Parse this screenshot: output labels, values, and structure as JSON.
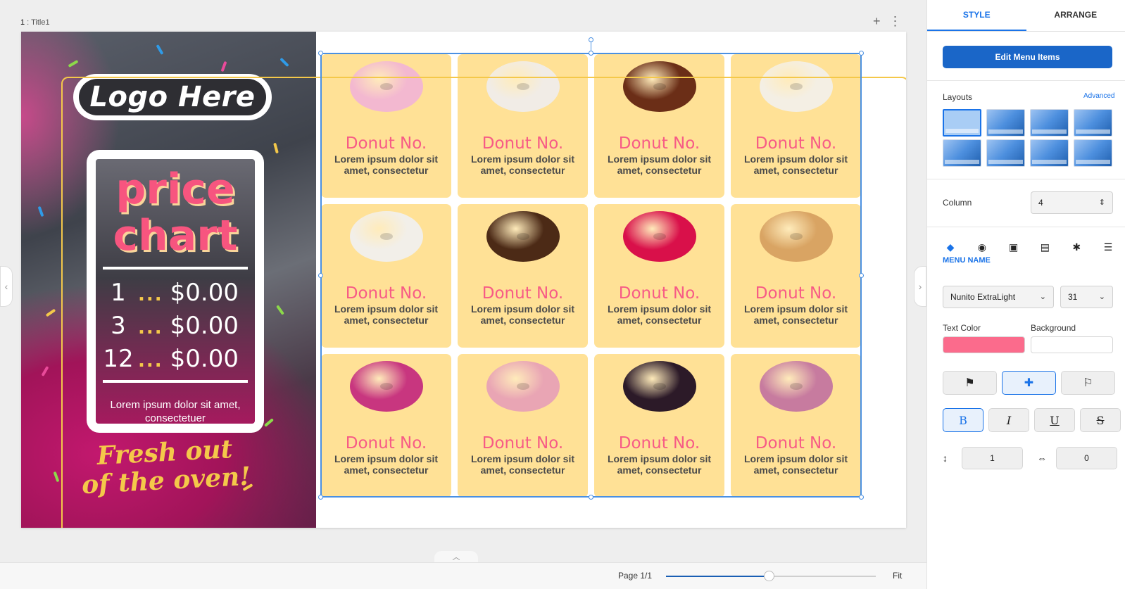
{
  "canvas": {
    "page_label_number": "1",
    "page_label_name": "Title1",
    "add_icon": "plus-icon",
    "more_icon": "more-vertical-icon"
  },
  "slide": {
    "logo_text": "Logo Here",
    "price_title_line1": "price",
    "price_title_line2": "chart",
    "price_rows": [
      {
        "qty": "1",
        "dots": "...",
        "price": "$0.00"
      },
      {
        "qty": "3",
        "dots": "...",
        "price": "$0.00"
      },
      {
        "qty": "12",
        "dots": "...",
        "price": "$0.00"
      }
    ],
    "price_description": "Lorem ipsum dolor sit amet, consectetuer",
    "tagline_line1": "Fresh out",
    "tagline_line2": "of the oven!",
    "menu_items": [
      {
        "name": "Donut No.",
        "description": "Lorem ipsum dolor sit amet, consectetur",
        "donut_color": "#f3b8d0"
      },
      {
        "name": "Donut No.",
        "description": "Lorem ipsum dolor sit amet, consectetur",
        "donut_color": "#f1ece6"
      },
      {
        "name": "Donut No.",
        "description": "Lorem ipsum dolor sit amet, consectetur",
        "donut_color": "#6b2e17"
      },
      {
        "name": "Donut No.",
        "description": "Lorem ipsum dolor sit amet, consectetur",
        "donut_color": "#f4efe4"
      },
      {
        "name": "Donut No.",
        "description": "Lorem ipsum dolor sit amet, consectetur",
        "donut_color": "#f2efe9"
      },
      {
        "name": "Donut No.",
        "description": "Lorem ipsum dolor sit amet, consectetur",
        "donut_color": "#4c2a16"
      },
      {
        "name": "Donut No.",
        "description": "Lorem ipsum dolor sit amet, consectetur",
        "donut_color": "#d9104a"
      },
      {
        "name": "Donut No.",
        "description": "Lorem ipsum dolor sit amet, consectetur",
        "donut_color": "#d9a463"
      },
      {
        "name": "Donut No.",
        "description": "Lorem ipsum dolor sit amet, consectetur",
        "donut_color": "#c8367f"
      },
      {
        "name": "Donut No.",
        "description": "Lorem ipsum dolor sit amet, consectetur",
        "donut_color": "#e9a5b4"
      },
      {
        "name": "Donut No.",
        "description": "Lorem ipsum dolor sit amet, consectetur",
        "donut_color": "#2c1a28"
      },
      {
        "name": "Donut No.",
        "description": "Lorem ipsum dolor sit amet, consectetur",
        "donut_color": "#c77b9f"
      }
    ],
    "colors": {
      "card_background": "#ffe196",
      "name_color": "#f75b86",
      "frame_outline": "#f4c84a",
      "selection": "#4a90e2"
    }
  },
  "bottom_bar": {
    "page_count": "Page 1/1",
    "zoom_percent": 49,
    "fit_label": "Fit",
    "collapse_icon": "chevron-up-icon"
  },
  "panel": {
    "tabs": [
      {
        "label": "STYLE",
        "active": true
      },
      {
        "label": "ARRANGE",
        "active": false
      }
    ],
    "edit_button": "Edit Menu Items",
    "layouts_title": "Layouts",
    "advanced_link": "Advanced",
    "column_label": "Column",
    "column_value": "4",
    "element_icons": [
      "tag-icon",
      "palette-icon",
      "image-icon",
      "image-text-icon",
      "sparkle-icon",
      "list-icon"
    ],
    "active_element_label": "MENU NAME",
    "font_family": "Nunito ExtraLight",
    "font_size": "31",
    "text_color_label": "Text Color",
    "background_label": "Background",
    "text_color": "#fb6b8c",
    "background_color": "#ffffff",
    "align_icons": [
      "align-left-icon",
      "align-center-icon",
      "align-right-icon"
    ],
    "format_buttons": [
      "B",
      "I",
      "U",
      "S"
    ],
    "line_spacing_value": "1",
    "letter_spacing_value": "0"
  }
}
